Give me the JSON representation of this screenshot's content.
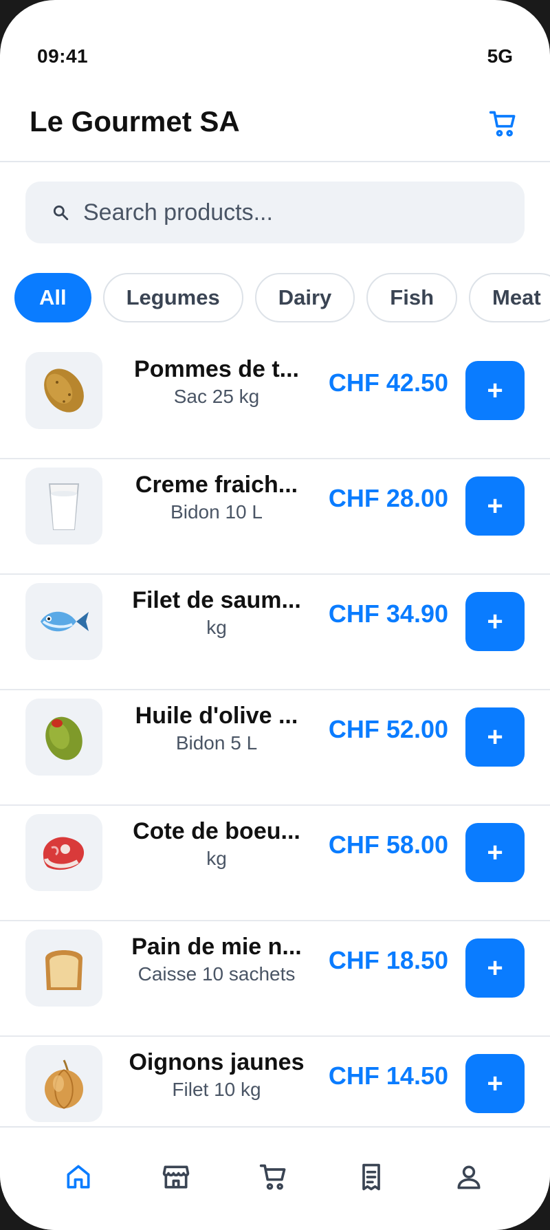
{
  "status_bar": {
    "time": "09:41",
    "network": "5G"
  },
  "header": {
    "title": "Le Gourmet SA",
    "cart_icon": "cart-icon"
  },
  "search": {
    "placeholder": "Search products..."
  },
  "categories": [
    {
      "label": "All",
      "active": true
    },
    {
      "label": "Legumes",
      "active": false
    },
    {
      "label": "Dairy",
      "active": false
    },
    {
      "label": "Fish",
      "active": false
    },
    {
      "label": "Meat",
      "active": false
    }
  ],
  "products": [
    {
      "name": "Pommes de t...",
      "unit": "Sac 25 kg",
      "price": "CHF 42.50",
      "emoji": "🥔",
      "add_label": "+"
    },
    {
      "name": "Creme fraich...",
      "unit": "Bidon 10 L",
      "price": "CHF 28.00",
      "emoji": "🥛",
      "add_label": "+"
    },
    {
      "name": "Filet de saum...",
      "unit": "kg",
      "price": "CHF 34.90",
      "emoji": "🐟",
      "add_label": "+"
    },
    {
      "name": "Huile d'olive ...",
      "unit": "Bidon 5 L",
      "price": "CHF 52.00",
      "emoji": "🫒",
      "add_label": "+"
    },
    {
      "name": "Cote de boeu...",
      "unit": "kg",
      "price": "CHF 58.00",
      "emoji": "🥩",
      "add_label": "+"
    },
    {
      "name": "Pain de mie n...",
      "unit": "Caisse 10 sachets",
      "price": "CHF 18.50",
      "emoji": "🍞",
      "add_label": "+"
    },
    {
      "name": "Oignons jaunes",
      "unit": "Filet 10 kg",
      "price": "CHF 14.50",
      "emoji": "🧅",
      "add_label": "+"
    }
  ],
  "bottom_nav": [
    {
      "icon": "home-icon",
      "active": true
    },
    {
      "icon": "store-icon",
      "active": false
    },
    {
      "icon": "cart-icon",
      "active": false
    },
    {
      "icon": "orders-icon",
      "active": false
    },
    {
      "icon": "profile-icon",
      "active": false
    }
  ],
  "colors": {
    "accent": "#0a7cff",
    "muted": "#4a5565",
    "surface": "#eff2f6"
  }
}
